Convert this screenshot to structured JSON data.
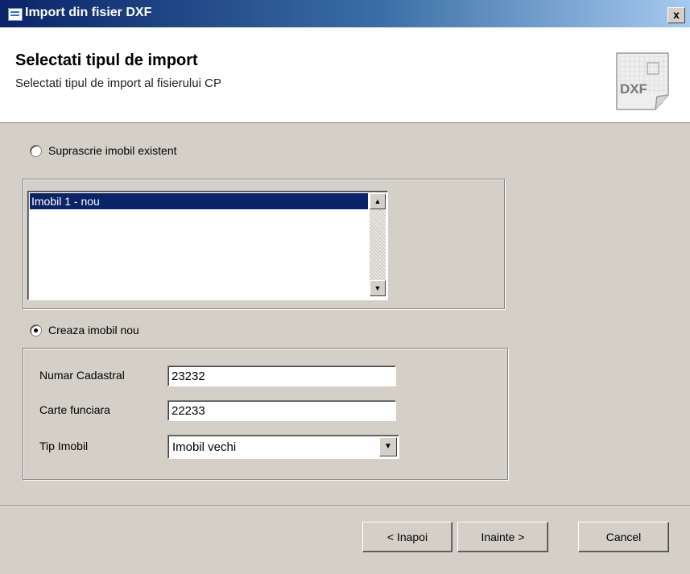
{
  "window": {
    "title": "Import din fisier DXF",
    "close_symbol": "x"
  },
  "header": {
    "title": "Selectati tipul de import",
    "subtitle": "Selectati tipul de import al fisierului CP",
    "icon_text": "DXF"
  },
  "option_overwrite": {
    "label": "Suprascrie imobil existent",
    "checked": false,
    "list_items": [
      "Imobil 1 - nou"
    ],
    "selected_index": 0
  },
  "option_create": {
    "label": "Creaza imobil nou",
    "checked": true,
    "fields": {
      "cadastral_label": "Numar Cadastral",
      "cadastral_value": "23232",
      "carte_label": "Carte funciara",
      "carte_value": "22233",
      "tip_label": "Tip Imobil",
      "tip_value": "Imobil vechi"
    }
  },
  "buttons": {
    "back": "< Inapoi",
    "next": "Inainte >",
    "cancel": "Cancel"
  },
  "colors": {
    "selection": "#0a246a",
    "dialog": "#d4d0c8",
    "title_start": "#0a246a"
  },
  "icons": {
    "window": "app-window-icon",
    "close": "close-icon",
    "dxf": "dxf-file-icon",
    "dropdown": "chevron-down-icon",
    "scroll_up": "scroll-up-icon",
    "scroll_down": "scroll-down-icon"
  }
}
